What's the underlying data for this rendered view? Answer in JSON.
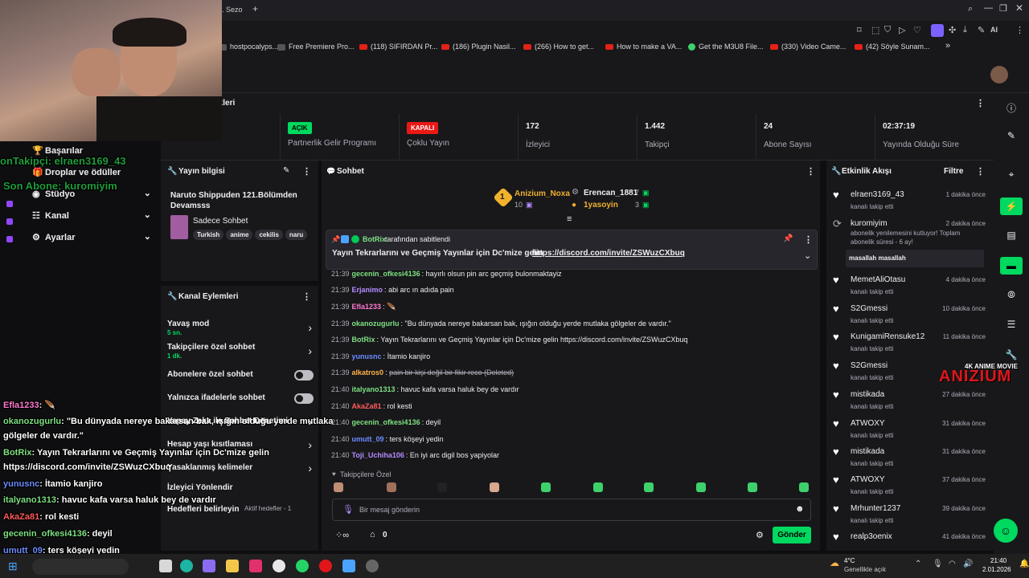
{
  "browser": {
    "tab_title": ". Sezo",
    "bookmarks": [
      {
        "label": "hostpocalyps...",
        "kind": "none"
      },
      {
        "label": "Free Premiere Pro...",
        "kind": "none"
      },
      {
        "label": "(118) SIFIRDAN Pr...",
        "kind": "yt"
      },
      {
        "label": "(186) Plugin Nasil...",
        "kind": "yt"
      },
      {
        "label": "(266) How to get...",
        "kind": "yt"
      },
      {
        "label": "How to make a VA...",
        "kind": "yt"
      },
      {
        "label": "Get the M3U8 File...",
        "kind": "green"
      },
      {
        "label": "(330) Video Came...",
        "kind": "yt"
      },
      {
        "label": "(42) Söyle Sunam...",
        "kind": "yt"
      }
    ],
    "ai_label": "AI"
  },
  "stats": {
    "section_title": "stikleri",
    "items": [
      {
        "value": "",
        "label": "Yayın"
      },
      {
        "value": "AÇIK",
        "label": "Partnerlik Gelir Programı",
        "badge_color": "#00d95f"
      },
      {
        "value": "KAPALI",
        "label": "Çoklu Yayın",
        "badge_color": "#e91916"
      },
      {
        "value": "172",
        "label": "İzleyici"
      },
      {
        "value": "1.442",
        "label": "Takipçi"
      },
      {
        "value": "24",
        "label": "Abone Sayısı"
      },
      {
        "value": "02:37:19",
        "label": "Yayında Olduğu Süre"
      }
    ]
  },
  "nav": {
    "items": [
      {
        "label": "Başarılar"
      },
      {
        "label": "Droplar ve ödüller"
      },
      {
        "label": "Stüdyo"
      },
      {
        "label": "Kanal"
      },
      {
        "label": "Ayarlar"
      }
    ]
  },
  "stream_info": {
    "title": "Yayın bilgisi",
    "stream_title": "Naruto Shippuden 121.Bölümden Devamsss",
    "category": "Sadece Sohbet",
    "tags": [
      "Turkish",
      "anime",
      "cekilis",
      "naru"
    ]
  },
  "channel_actions": {
    "title": "Kanal Eylemleri",
    "items": [
      {
        "label": "Yavaş mod",
        "sub": "5 sn."
      },
      {
        "label": "Takipçilere özel sohbet",
        "sub": "1 dk."
      },
      {
        "label": "Abonelere özel sohbet",
        "sub": ""
      },
      {
        "label": "Yalnızca ifadelerle sohbet",
        "sub": ""
      },
      {
        "label": "Yapay Zeka ile Sohbet Denetimi",
        "sub": ""
      },
      {
        "label": "Hesap yaşı kısıtlaması",
        "sub": ""
      },
      {
        "label": "Yasaklanmış kelimeler",
        "sub": ""
      },
      {
        "label": "İzleyici Yönlendir",
        "sub": ""
      },
      {
        "label": "Hedefleri belirleyin",
        "sub": "Aktif hedefler - 1"
      }
    ]
  },
  "chat": {
    "title": "Sohbet",
    "leaders": [
      {
        "rank": "1",
        "name": "Anizium_Noxa",
        "count": "10"
      },
      {
        "rank": "",
        "name": "Erencan_1881",
        "count": "7"
      },
      {
        "rank": "",
        "name": "1yasoyin",
        "count": "3"
      }
    ],
    "pinned": {
      "by_user": "BotRix",
      "by_suffix": "tarafından sabitlendi",
      "text": "Yayın Tekrarlarını ve Geçmiş Yayınlar için Dc'mize gelin",
      "link": "https://discord.com/invite/ZSWuzCXbuq"
    },
    "messages": [
      {
        "time": "21:39",
        "user": "gecenin_ofkesi4136",
        "color": "#7ee081",
        "text": "hayırlı olsun pin arc geçmiş bulonmaktayiz"
      },
      {
        "time": "21:39",
        "user": "Erjanimo",
        "color": "#b58cff",
        "text": "abi arc ın adıda pain"
      },
      {
        "time": "21:39",
        "user": "Efla1233",
        "color": "#ff7ad1",
        "text": "🪶"
      },
      {
        "time": "21:39",
        "user": "okanozugurlu",
        "color": "#7ee081",
        "text": "\"Bu dünyada nereye bakarsan bak, ışığın olduğu yerde mutlaka gölgeler de vardır.\""
      },
      {
        "time": "21:39",
        "user": "BotRix",
        "color": "#7ee081",
        "text": "Yayın Tekrarlarını ve Geçmiş Yayınlar için Dc'mize gelin https://discord.com/invite/ZSWuzCXbuq"
      },
      {
        "time": "21:39",
        "user": "yunusnc",
        "color": "#6b8cff",
        "text": "İtamio kanjiro"
      },
      {
        "time": "21:39",
        "user": "alkatros0",
        "color": "#ffb347",
        "text": "pain bir kişi değil bir fikir reco (Deleted)"
      },
      {
        "time": "21:40",
        "user": "italyano1313",
        "color": "#7ee081",
        "text": "havuc kafa varsa haluk bey de vardır"
      },
      {
        "time": "21:40",
        "user": "AkaZa81",
        "color": "#ff5a5a",
        "text": "rol kesti"
      },
      {
        "time": "21:40",
        "user": "gecenin_ofkesi4136",
        "color": "#7ee081",
        "text": "deyil"
      },
      {
        "time": "21:40",
        "user": "umutt_09",
        "color": "#6b8cff",
        "text": "ters köşeyi yedin"
      },
      {
        "time": "21:40",
        "user": "Toji_Uchiha106",
        "color": "#b58cff",
        "text": "En iyi arc digil bos yapiyolar"
      }
    ],
    "followers_only": "Takipçilere Özel",
    "input_placeholder": "Bir mesaj gönderin",
    "points": "0",
    "send_label": "Gönder"
  },
  "activity": {
    "title": "Etkinlik Akışı",
    "filter_label": "Filtre",
    "events": [
      {
        "name": "elraen3169_43",
        "sub": "kanalı takip etti",
        "ago": "1 dakika önce"
      },
      {
        "name": "kuromiyim",
        "sub": "abonelik yenilemesini kutluyor! Toplam abonelik süresi - 6 ay!",
        "ago": "2 dakika önce",
        "message": "masallah masallah"
      },
      {
        "name": "MemetAliOtasu",
        "sub": "kanalı takip etti",
        "ago": "4 dakika önce"
      },
      {
        "name": "S2Gmessi",
        "sub": "kanalı takip etti",
        "ago": "10 dakika önce"
      },
      {
        "name": "KunigamiRensuke12",
        "sub": "kanalı takip etti",
        "ago": "11 dakika önce"
      },
      {
        "name": "S2Gmessi",
        "sub": "kanalı takip etti",
        "ago": ""
      },
      {
        "name": "mistikada",
        "sub": "kanalı takip etti",
        "ago": "27 dakika önce"
      },
      {
        "name": "ATWOXY",
        "sub": "kanalı takip etti",
        "ago": "31 dakika önce"
      },
      {
        "name": "mistikada",
        "sub": "kanalı takip etti",
        "ago": "31 dakika önce"
      },
      {
        "name": "ATWOXY",
        "sub": "kanalı takip etti",
        "ago": "37 dakika önce"
      },
      {
        "name": "Mrhunter1237",
        "sub": "kanalı takip etti",
        "ago": "39 dakika önce"
      },
      {
        "name": "realp3oenix",
        "sub": "",
        "ago": "41 dakika önce"
      }
    ]
  },
  "overlay": {
    "last_follower": "onTakipçi: elraen3169_43",
    "last_sub": "Son Abone: kuromiyim",
    "watermark_top": "4K ANIME MOVIE",
    "watermark_logo": "ANIZIUM",
    "chat": [
      {
        "user": "Efla1233",
        "text": ": 🪶",
        "color": "#ff7ad1"
      },
      {
        "user": "okanozugurlu",
        "text": ": \"Bu dünyada nereye bakarsan bak, ışığın olduğu yerde mutlaka",
        "color": "#7ee081"
      },
      {
        "user": "",
        "text": "gölgeler de vardır.\"",
        "color": "#fff"
      },
      {
        "user": "BotRix",
        "text": ": Yayın Tekrarlarını ve Geçmiş Yayınlar için Dc'mize gelin",
        "color": "#7ee081"
      },
      {
        "user": "",
        "text": "https://discord.com/invite/ZSWuzCXbuq",
        "color": "#fff"
      },
      {
        "user": "yunusnc",
        "text": ": İtamio kanjiro",
        "color": "#6b8cff"
      },
      {
        "user": "italyano1313",
        "text": ": havuc kafa varsa haluk bey de vardır",
        "color": "#7ee081"
      },
      {
        "user": "AkaZa81",
        "text": ": rol kesti",
        "color": "#ff5a5a"
      },
      {
        "user": "gecenin_ofkesi4136",
        "text": ": deyil",
        "color": "#7ee081"
      },
      {
        "user": "umutt_09",
        "text": ": ters köşeyi yedin",
        "color": "#6b8cff"
      },
      {
        "user": "Toji_Uchiha106",
        "text": ": En iyi arc digil bos yapiyolar",
        "color": "#b58cff"
      }
    ]
  },
  "taskbar": {
    "weather_temp": "4°C",
    "weather_desc": "Genellikle açık",
    "time": "21:40",
    "date": "2.01.2026"
  }
}
